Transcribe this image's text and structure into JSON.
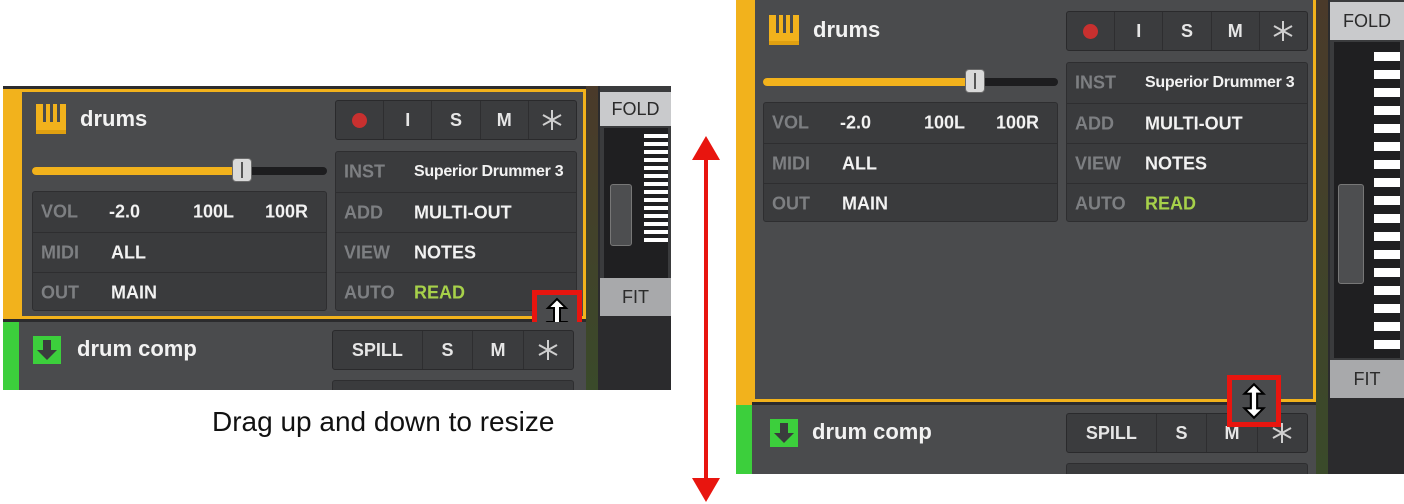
{
  "left": {
    "track1": {
      "name": "drums",
      "buttons": [
        "I",
        "S",
        "M"
      ],
      "vol_label": "VOL",
      "vol_value": "-2.0",
      "pan_l": "100L",
      "pan_r": "100R",
      "midi_label": "MIDI",
      "midi_value": "ALL",
      "out_label": "OUT",
      "out_value": "MAIN",
      "inst_label": "INST",
      "inst_value": "Superior Drummer 3",
      "add_label": "ADD",
      "add_value": "MULTI-OUT",
      "view_label": "VIEW",
      "view_value": "NOTES",
      "auto_label": "AUTO",
      "auto_value": "READ",
      "fader_level": 0.65
    },
    "track2": {
      "name": "drum comp",
      "buttons": [
        "SPILL",
        "S",
        "M"
      ]
    },
    "fold_label": "FOLD",
    "fit_label": "FIT"
  },
  "right": {
    "track1": {
      "name": "drums",
      "buttons": [
        "I",
        "S",
        "M"
      ],
      "vol_label": "VOL",
      "vol_value": "-2.0",
      "pan_l": "100L",
      "pan_r": "100R",
      "midi_label": "MIDI",
      "midi_value": "ALL",
      "out_label": "OUT",
      "out_value": "MAIN",
      "inst_label": "INST",
      "inst_value": "Superior Drummer 3",
      "add_label": "ADD",
      "add_value": "MULTI-OUT",
      "view_label": "VIEW",
      "view_value": "NOTES",
      "auto_label": "AUTO",
      "auto_value": "READ",
      "fader_level": 0.7
    },
    "track2": {
      "name": "drum comp",
      "buttons": [
        "SPILL",
        "S",
        "M"
      ]
    },
    "fold_label": "FOLD",
    "fit_label": "FIT"
  },
  "caption": "Drag up and down to resize",
  "colors": {
    "selected_border": "#f2b21c",
    "track_bg": "#4a4b4d",
    "auto_read": "#a7d14a",
    "highlight": "#e8150f",
    "record": "#c8302f"
  },
  "icons": [
    "piano-keys-icon",
    "record-icon",
    "snowflake-icon",
    "folder-arrow-icon",
    "resize-updown-icon",
    "double-arrow-icon"
  ]
}
